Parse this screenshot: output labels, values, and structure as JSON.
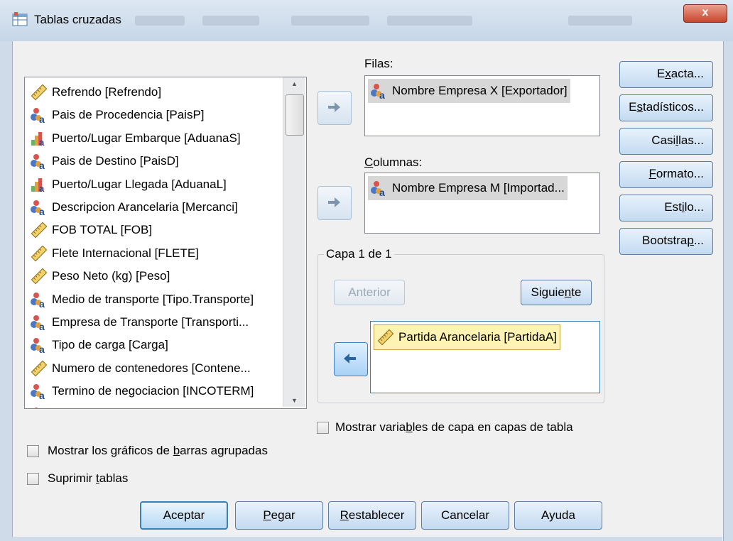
{
  "window": {
    "title": "Tablas cruzadas",
    "close_label": "x"
  },
  "variables": [
    {
      "label": "Refrendo [Refrendo]",
      "icon": "ruler-icon"
    },
    {
      "label": "Pais de Procedencia [PaisP]",
      "icon": "nominal-icon"
    },
    {
      "label": "Puerto/Lugar Embarque [AduanaS]",
      "icon": "ordinal-icon"
    },
    {
      "label": "Pais de Destino [PaisD]",
      "icon": "nominal-icon"
    },
    {
      "label": "Puerto/Lugar Llegada [AduanaL]",
      "icon": "ordinal-icon"
    },
    {
      "label": "Descripcion Arancelaria [Mercanci]",
      "icon": "nominal-icon"
    },
    {
      "label": "FOB TOTAL [FOB]",
      "icon": "ruler-icon"
    },
    {
      "label": "Flete Internacional [FLETE]",
      "icon": "ruler-icon"
    },
    {
      "label": "Peso Neto (kg) [Peso]",
      "icon": "ruler-icon"
    },
    {
      "label": "Medio de transporte [Tipo.Transporte]",
      "icon": "nominal-icon"
    },
    {
      "label": "Empresa de Transporte [Transporti...",
      "icon": "nominal-icon"
    },
    {
      "label": "Tipo de carga [Carga]",
      "icon": "nominal-icon"
    },
    {
      "label": "Numero de contenedores [Contene...",
      "icon": "ruler-icon"
    },
    {
      "label": "Termino de negociacion [INCOTERM]",
      "icon": "nominal-icon"
    }
  ],
  "filas": {
    "label": "Filas:",
    "item": "Nombre Empresa X [Exportador]"
  },
  "columnas": {
    "label": "Columnas:",
    "item": "Nombre Empresa M [Importad..."
  },
  "capa": {
    "title": "Capa 1 de 1",
    "anterior": "Anterior",
    "siguiente_pre": "Siguie",
    "siguiente_u": "n",
    "siguiente_post": "te",
    "item": "Partida Arancelaria [PartidaA]"
  },
  "side_buttons": [
    {
      "pre": "E",
      "u": "x",
      "post": "acta..."
    },
    {
      "pre": "E",
      "u": "s",
      "post": "tadísticos..."
    },
    {
      "pre": "Casi",
      "u": "l",
      "post": "las..."
    },
    {
      "pre": "",
      "u": "F",
      "post": "ormato..."
    },
    {
      "pre": "Est",
      "u": "i",
      "post": "lo..."
    },
    {
      "pre": "Bootstra",
      "u": "p",
      "post": "..."
    }
  ],
  "checkboxes": {
    "mostrar_capa": {
      "pre": "Mostrar varia",
      "u": "b",
      "post": "les de capa en capas de tabla",
      "checked": false
    },
    "graficos": {
      "pre": "Mostrar los gráficos de ",
      "u": "b",
      "post": "arras agrupadas",
      "checked": false
    },
    "suprimir": {
      "pre": "Suprimir ",
      "u": "t",
      "post": "ablas",
      "checked": false
    }
  },
  "bottom_buttons": {
    "aceptar": "Aceptar",
    "pegar_u": "P",
    "pegar_post": "egar",
    "restablecer_u": "R",
    "restablecer_post": "establecer",
    "cancelar": "Cancelar",
    "ayuda": "Ayuda"
  },
  "colors": {
    "accent": "#3c7fb1",
    "selected_yellow": "#fff3b4",
    "selected_gray": "#d7d7d7"
  }
}
